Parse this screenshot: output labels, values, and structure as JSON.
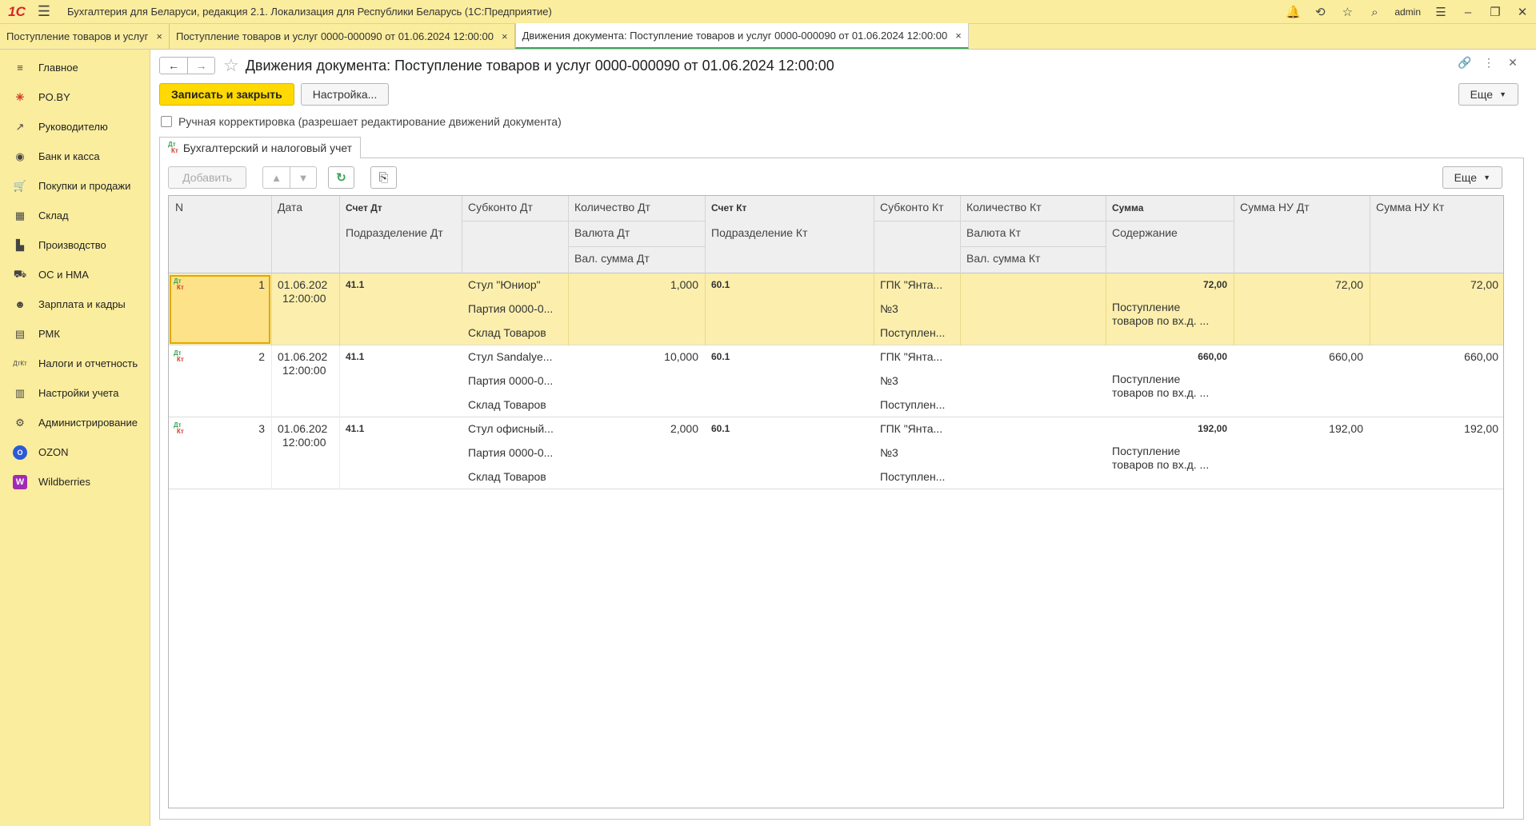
{
  "titlebar": {
    "logo": "1С",
    "title": "Бухгалтерия для Беларуси, редакция 2.1. Локализация для Республики Беларусь   (1С:Предприятие)",
    "user": "admin"
  },
  "tabs": [
    {
      "label": "Поступление товаров и услуг",
      "close": "×"
    },
    {
      "label": "Поступление товаров и услуг 0000-000090 от 01.06.2024 12:00:00",
      "close": "×"
    },
    {
      "label": "Движения документа: Поступление товаров и услуг 0000-000090 от 01.06.2024 12:00:00",
      "close": "×"
    }
  ],
  "sidebar": {
    "items": [
      {
        "label": "Главное",
        "icon": "≡"
      },
      {
        "label": "PO.BY",
        "icon": "✳"
      },
      {
        "label": "Руководителю",
        "icon": "↗"
      },
      {
        "label": "Банк и касса",
        "icon": "◉"
      },
      {
        "label": "Покупки и продажи",
        "icon": "🛒"
      },
      {
        "label": "Склад",
        "icon": "▦"
      },
      {
        "label": "Производство",
        "icon": "▙"
      },
      {
        "label": "ОС и НМА",
        "icon": "⛟"
      },
      {
        "label": "Зарплата и кадры",
        "icon": "☻"
      },
      {
        "label": "РМК",
        "icon": "▤"
      },
      {
        "label": "Налоги и отчетность",
        "icon": "ДтКт"
      },
      {
        "label": "Настройки учета",
        "icon": "▥"
      },
      {
        "label": "Администрирование",
        "icon": "⚙"
      },
      {
        "label": "OZON",
        "icon": "O"
      },
      {
        "label": "Wildberries",
        "icon": "W"
      }
    ]
  },
  "page": {
    "title": "Движения документа: Поступление товаров и услуг 0000-000090 от 01.06.2024 12:00:00",
    "save_close": "Записать и закрыть",
    "settings": "Настройка...",
    "more": "Еще",
    "manual_edit": "Ручная корректировка (разрешает редактирование движений документа)",
    "section_tab": "Бухгалтерский и налоговый учет",
    "add": "Добавить",
    "table_more": "Еще"
  },
  "grid": {
    "headers": {
      "n": "N",
      "date": "Дата",
      "acc_dt": "Счет Дт",
      "div_dt": "Подразделение Дт",
      "sub_dt": "Субконто Дт",
      "qty_dt": "Количество Дт",
      "cur_dt": "Валюта Дт",
      "cursum_dt": "Вал. сумма Дт",
      "acc_kt": "Счет Кт",
      "div_kt": "Подразделение Кт",
      "sub_kt": "Субконто Кт",
      "qty_kt": "Количество Кт",
      "cur_kt": "Валюта Кт",
      "cursum_kt": "Вал. сумма Кт",
      "sum": "Сумма",
      "content": "Содержание",
      "sum_nu_dt": "Сумма НУ Дт",
      "sum_nu_kt": "Сумма НУ Кт"
    },
    "rows": [
      {
        "n": "1",
        "date1": "01.06.202",
        "date2": "12:00:00",
        "acc_dt": "41.1",
        "sub1": "Стул \"Юниор\"",
        "sub2": "Партия 0000-0...",
        "sub3": "Склад Товаров",
        "qty": "1,000",
        "acc_kt": "60.1",
        "subk1": "ГПК \"Янта...",
        "subk2": "№3",
        "subk3": "Поступлен...",
        "sum": "72,00",
        "content": "Поступление товаров по вх.д. ...",
        "nu_dt": "72,00",
        "nu_kt": "72,00"
      },
      {
        "n": "2",
        "date1": "01.06.202",
        "date2": "12:00:00",
        "acc_dt": "41.1",
        "sub1": "Стул Sandalye...",
        "sub2": "Партия 0000-0...",
        "sub3": "Склад Товаров",
        "qty": "10,000",
        "acc_kt": "60.1",
        "subk1": "ГПК \"Янта...",
        "subk2": "№3",
        "subk3": "Поступлен...",
        "sum": "660,00",
        "content": "Поступление товаров по вх.д. ...",
        "nu_dt": "660,00",
        "nu_kt": "660,00"
      },
      {
        "n": "3",
        "date1": "01.06.202",
        "date2": "12:00:00",
        "acc_dt": "41.1",
        "sub1": "Стул офисный...",
        "sub2": "Партия 0000-0...",
        "sub3": "Склад Товаров",
        "qty": "2,000",
        "acc_kt": "60.1",
        "subk1": "ГПК \"Янта...",
        "subk2": "№3",
        "subk3": "Поступлен...",
        "sum": "192,00",
        "content": "Поступление товаров по вх.д. ...",
        "nu_dt": "192,00",
        "nu_kt": "192,00"
      }
    ]
  },
  "colors": {
    "accent": "#ffd900",
    "sidebar": "#fbed9e",
    "selected_row": "#fcefad",
    "active_tab": "#3aa65a"
  }
}
